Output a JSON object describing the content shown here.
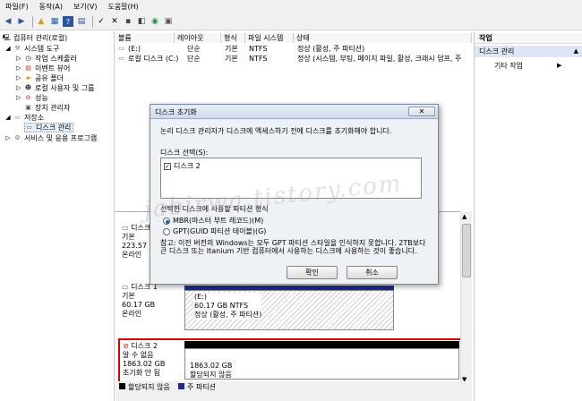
{
  "menu": [
    "파일(F)",
    "동작(A)",
    "보기(V)",
    "도움말(H)"
  ],
  "toolbar_icons": [
    "back-icon",
    "forward-icon",
    "up-folder-icon",
    "grid-icon",
    "help-icon",
    "list-icon",
    "refresh-icon",
    "delete-icon",
    "properties-icon",
    "import-icon",
    "search-icon",
    "disk-icon"
  ],
  "tree": {
    "root": "컴퓨터 관리(로컬)",
    "system_tools": "시스템 도구",
    "task_scheduler": "작업 스케줄러",
    "event_viewer": "이벤트 뷰어",
    "shared_folders": "공유 폴더",
    "local_users": "로컬 사용자 및 그룹",
    "performance": "성능",
    "device_manager": "장치 관리자",
    "storage": "저장소",
    "disk_management": "디스크 관리",
    "services": "서비스 및 응용 프로그램"
  },
  "volumes": {
    "headers": [
      "볼륨",
      "레이아웃",
      "형식",
      "파일 시스템",
      "상태"
    ],
    "rows": [
      {
        "name": "(E:)",
        "layout": "단순",
        "type": "기본",
        "fs": "NTFS",
        "status": "정상 (활성, 주 파티션)"
      },
      {
        "name": "로컬 디스크 (C:)",
        "layout": "단순",
        "type": "기본",
        "fs": "NTFS",
        "status": "정상 (시스템, 부팅, 페이지 파일, 활성, 크래시 덤프, 주"
      }
    ]
  },
  "actions": {
    "header": "작업",
    "section": "디스크 관리",
    "more": "기타 작업"
  },
  "disks": [
    {
      "name": "디스크",
      "type": "기본",
      "size": "223.57 G",
      "status": "온라인"
    },
    {
      "name": "디스크 1",
      "type": "기본",
      "size": "60.17 GB",
      "status": "온라인",
      "part_name": "(E:)",
      "part_size": "60.17 GB NTFS",
      "part_status": "정상 (활성, 주 파티션)"
    },
    {
      "name": "디스크 2",
      "type": "알 수 없음",
      "size": "1863.02 GB",
      "status": "초기화 안 됨",
      "part_size": "1863.02 GB",
      "part_status": "할당되지 않음"
    }
  ],
  "legend": [
    "할당되지 않음",
    "주 파티션"
  ],
  "dialog": {
    "title": "디스크 초기화",
    "message": "논리 디스크 관리자가 디스크에 액세스하기 전에 디스크를 초기화해야 합니다.",
    "select_label": "디스크 선택(S):",
    "disk_item": "디스크 2",
    "style_label": "선택한 디스크에 사용할 파티션 형식",
    "mbr": "MBR(마스터 부트 레코드)(M)",
    "gpt": "GPT(GUID 파티션 테이블)(G)",
    "note": "참고: 이전 버전의 Windows는 모두 GPT 파티션 스타일을 인식하지 못합니다. 2TB보다 큰 디스크 또는 Itanium 기반 컴퓨터에서 사용하는 디스크에 사용하는 것이 좋습니다.",
    "ok": "확인",
    "cancel": "취소"
  },
  "watermark": "jabirwa.tistory.com",
  "colors": {
    "highlight": "#e00000",
    "primary_partition": "#1c2a8c",
    "unallocated": "#000000"
  }
}
